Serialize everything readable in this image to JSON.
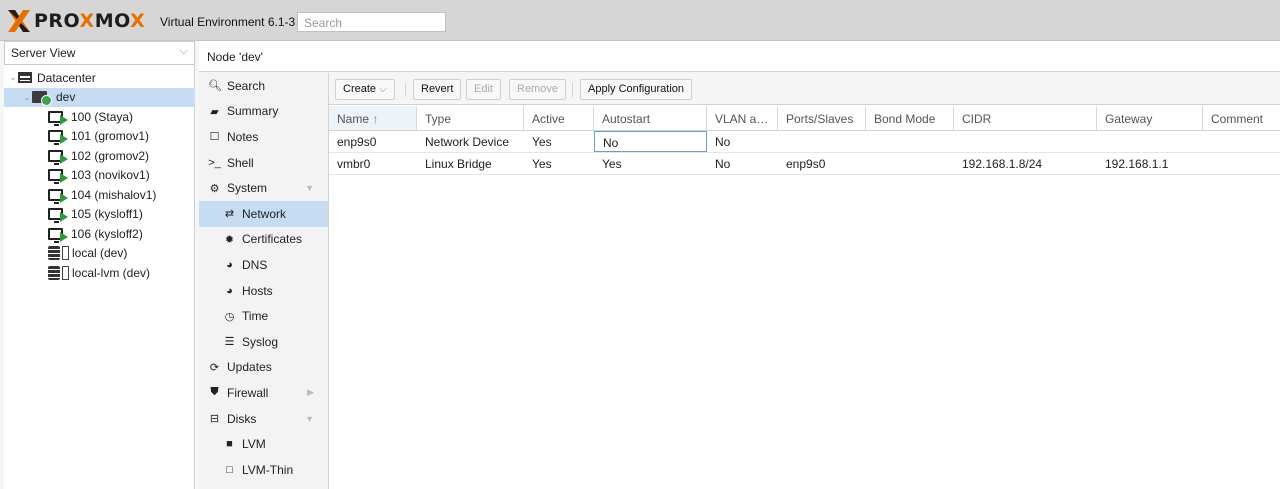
{
  "app": {
    "brand_left": "PRO",
    "brand_x": "X",
    "brand_mid": "MO",
    "brand_x2": "X",
    "version": "Virtual Environment 6.1-3",
    "search_placeholder": "Search",
    "accent": "#e57000"
  },
  "left": {
    "view": "Server View",
    "tree": [
      {
        "label": "Datacenter",
        "icon": "datacenter-icon"
      },
      {
        "label": "dev",
        "icon": "node-online-icon"
      },
      {
        "label": "100 (Staya)",
        "icon": "vm-running-icon"
      },
      {
        "label": "101 (gromov1)",
        "icon": "vm-running-icon"
      },
      {
        "label": "102 (gromov2)",
        "icon": "vm-running-icon"
      },
      {
        "label": "103 (novikov1)",
        "icon": "vm-running-icon"
      },
      {
        "label": "104 (mishalov1)",
        "icon": "vm-running-icon"
      },
      {
        "label": "105 (kysloff1)",
        "icon": "vm-running-icon"
      },
      {
        "label": "106 (kysloff2)",
        "icon": "vm-running-icon"
      },
      {
        "label": "local (dev)",
        "icon": "storage-icon"
      },
      {
        "label": "local-lvm (dev)",
        "icon": "storage-icon"
      }
    ]
  },
  "node_header": "Node 'dev'",
  "menu": [
    {
      "label": "Search",
      "icon": "search-icon"
    },
    {
      "label": "Summary",
      "icon": "book-icon"
    },
    {
      "label": "Notes",
      "icon": "notes-icon"
    },
    {
      "label": "Shell",
      "icon": "terminal-icon"
    },
    {
      "label": "System",
      "icon": "gears-icon"
    },
    {
      "label": "Network",
      "icon": "exchange-icon"
    },
    {
      "label": "Certificates",
      "icon": "certificate-icon"
    },
    {
      "label": "DNS",
      "icon": "globe-icon"
    },
    {
      "label": "Hosts",
      "icon": "globe-icon"
    },
    {
      "label": "Time",
      "icon": "clock-icon"
    },
    {
      "label": "Syslog",
      "icon": "list-icon"
    },
    {
      "label": "Updates",
      "icon": "refresh-icon"
    },
    {
      "label": "Firewall",
      "icon": "shield-icon"
    },
    {
      "label": "Disks",
      "icon": "hdd-icon"
    },
    {
      "label": "LVM",
      "icon": "square-icon"
    },
    {
      "label": "LVM-Thin",
      "icon": "square-outline-icon"
    }
  ],
  "toolbar": {
    "create": "Create",
    "revert": "Revert",
    "edit": "Edit",
    "remove": "Remove",
    "apply": "Apply Configuration"
  },
  "grid": {
    "columns": [
      "Name",
      "Type",
      "Active",
      "Autostart",
      "VLAN a…",
      "Ports/Slaves",
      "Bond Mode",
      "CIDR",
      "Gateway",
      "Comment"
    ],
    "rows": [
      [
        "enp9s0",
        "Network Device",
        "Yes",
        "No",
        "No",
        "",
        "",
        "",
        "",
        ""
      ],
      [
        "vmbr0",
        "Linux Bridge",
        "Yes",
        "Yes",
        "No",
        "enp9s0",
        "",
        "192.168.1.8/24",
        "192.168.1.1",
        ""
      ]
    ]
  }
}
